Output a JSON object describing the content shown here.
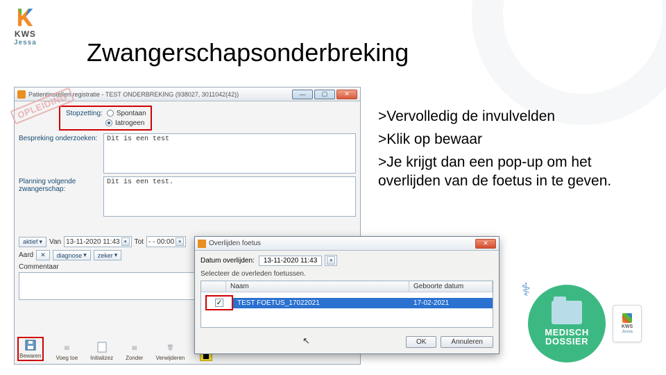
{
  "logo": {
    "line1": "KWS",
    "line2": "Jessa"
  },
  "page_title": "Zwangerschapsonderbreking",
  "app": {
    "titlebar": "Patientinstellen registratie - TEST ONDERBREKING (938027, 3011042(42))",
    "stamp": "OPLEIDING",
    "stopzetting": {
      "label": "Stopzetting:",
      "opt1": "Spontaan",
      "opt2": "Iatrogeen"
    },
    "bespreking": {
      "label": "Bespreking onderzoeken:",
      "value": "Dit is een test"
    },
    "planning": {
      "label": "Planning volgende zwangerschap:",
      "value": "Dit is een test."
    },
    "aktief": {
      "label": "aktief",
      "van": "Van",
      "van_value": "13-11-2020 11:43",
      "tot": "Tot",
      "tot_value": "- - 00:00"
    },
    "aard": {
      "label": "Aard",
      "diagnose": "diagnose",
      "zeker": "zeker"
    },
    "commentaar": "Commentaar",
    "toolbar": {
      "bewaren": "Bewaren",
      "voeg": "Voeg toe",
      "init": "Initializez",
      "zonder": "Zonder",
      "verw": "Verwijderen"
    }
  },
  "popup": {
    "title": "Overlijden foetus",
    "datum_label": "Datum overlijden:",
    "datum_value": "13-11-2020 11:43",
    "selecteer": "Selecteer de overleden foetussen.",
    "col_naam": "Naam",
    "col_date": "Geboorte datum",
    "row_naam": "TEST FOETUS_17022021",
    "row_date": "17-02-2021",
    "ok": "OK",
    "annuleren": "Annuleren"
  },
  "instructions": {
    "l1": ">Vervolledig de invulvelden",
    "l2": ">Klik op bewaar",
    "l3": ">Je krijgt dan een pop-up om het overlijden van de foetus in te geven."
  },
  "badge": {
    "line1": "MEDISCH",
    "line2": "DOSSIER",
    "mini1": "KWS",
    "mini2": "Jessa"
  }
}
